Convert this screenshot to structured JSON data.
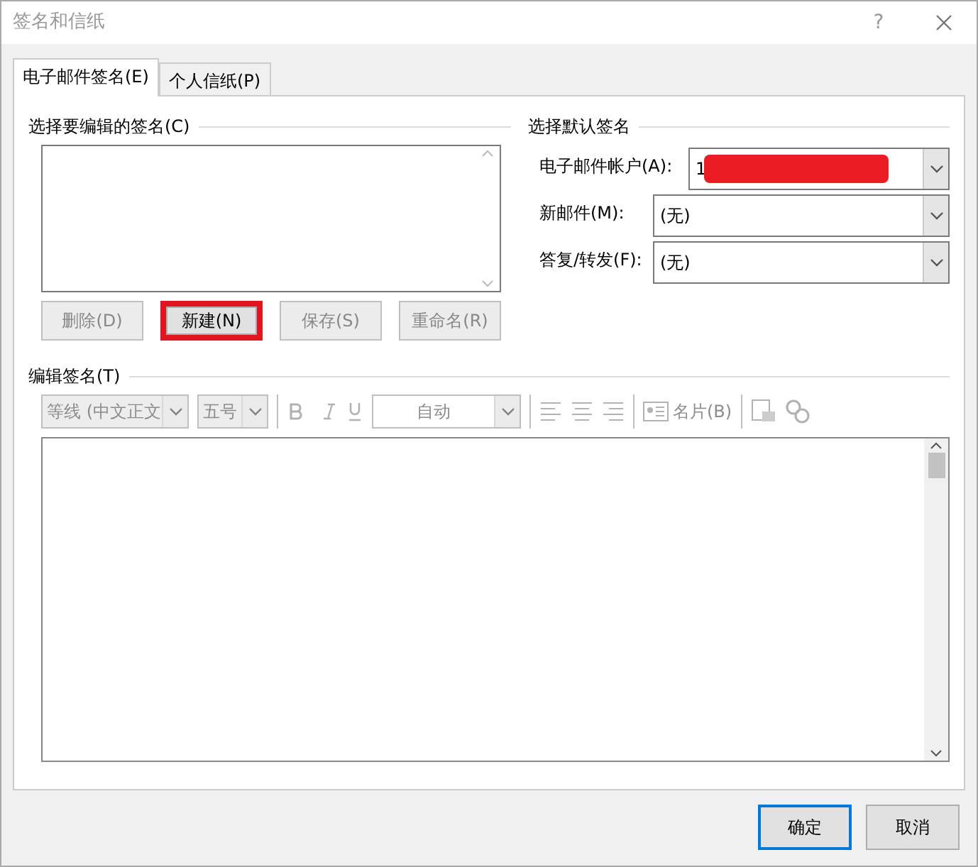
{
  "window": {
    "title": "签名和信纸",
    "help": "?"
  },
  "tabs": [
    {
      "label": "电子邮件签名(E)",
      "selected": true
    },
    {
      "label": "个人信纸(P)",
      "selected": false
    }
  ],
  "signatures": {
    "heading": "选择要编辑的签名(C)",
    "buttons": [
      {
        "label": "删除(D)",
        "disabled": true,
        "highlighted": false
      },
      {
        "label": "新建(N)",
        "disabled": false,
        "highlighted": true
      },
      {
        "label": "保存(S)",
        "disabled": true,
        "highlighted": false
      },
      {
        "label": "重命名(R)",
        "disabled": true,
        "highlighted": false
      }
    ]
  },
  "defaults": {
    "heading": "选择默认签名",
    "fields": [
      {
        "label": "电子邮件帐户(A):",
        "value": "1",
        "redacted": true
      },
      {
        "label": "新邮件(M):",
        "value": "(无)",
        "redacted": false
      },
      {
        "label": "答复/转发(F):",
        "value": "(无)",
        "redacted": false
      }
    ]
  },
  "editor": {
    "heading": "编辑签名(T)",
    "font": "等线 (中文正文",
    "size": "五号",
    "auto_color": "自动",
    "card_button": "名片(B)",
    "disabled": true
  },
  "footer_buttons": [
    {
      "label": "确定",
      "default": true
    },
    {
      "label": "取消",
      "default": false
    }
  ]
}
